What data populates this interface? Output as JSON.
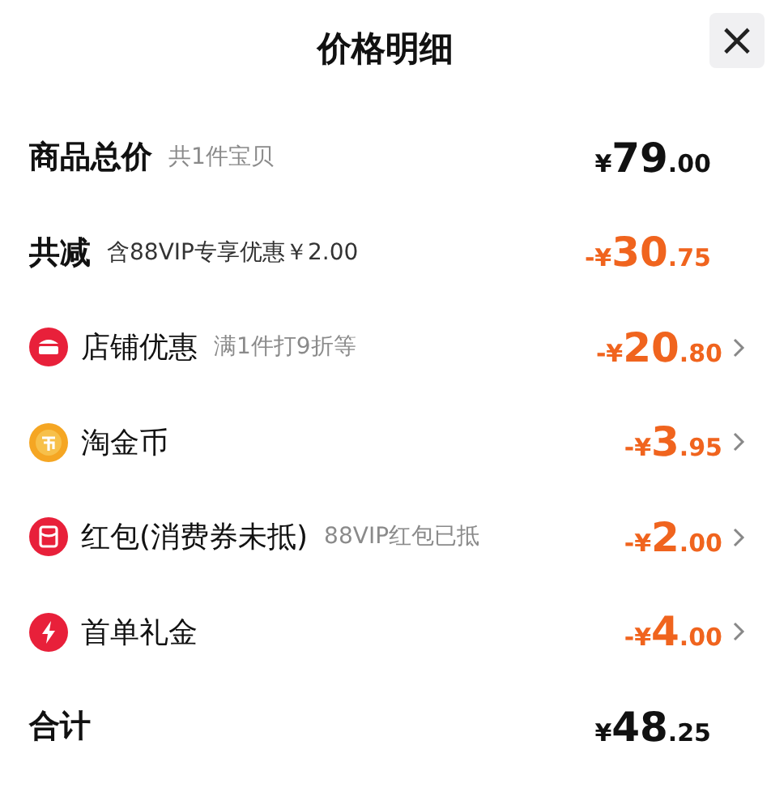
{
  "title": "价格明细",
  "close": "×",
  "rows": [
    {
      "kind": "total",
      "label": "商品总价",
      "note": "共1件宝贝",
      "price": {
        "currency": "¥",
        "integer": "79",
        "decimal": ".00"
      }
    },
    {
      "kind": "reduction",
      "label": "共减",
      "note": "含88VIP专享优惠￥2.00",
      "price": {
        "currency": "-¥",
        "integer": "30",
        "decimal": ".75"
      }
    },
    {
      "kind": "store",
      "label": "店铺优惠",
      "note": "满1件打9折等",
      "price": {
        "currency": "-¥",
        "integer": "20",
        "decimal": ".80"
      }
    },
    {
      "kind": "coin",
      "label": "淘金币",
      "price": {
        "currency": "-¥",
        "integer": "3",
        "decimal": ".95"
      }
    },
    {
      "kind": "red_packet",
      "label": "红包(消费券未抵)",
      "note": "88VIP红包已抵",
      "price": {
        "currency": "-¥",
        "integer": "2",
        "decimal": ".00"
      }
    },
    {
      "kind": "gift",
      "label": "首单礼金",
      "price": {
        "currency": "-¥",
        "integer": "4",
        "decimal": ".00"
      }
    },
    {
      "kind": "total",
      "label": "合计",
      "price": {
        "currency": "¥",
        "integer": "48",
        "decimal": ".25"
      }
    }
  ]
}
